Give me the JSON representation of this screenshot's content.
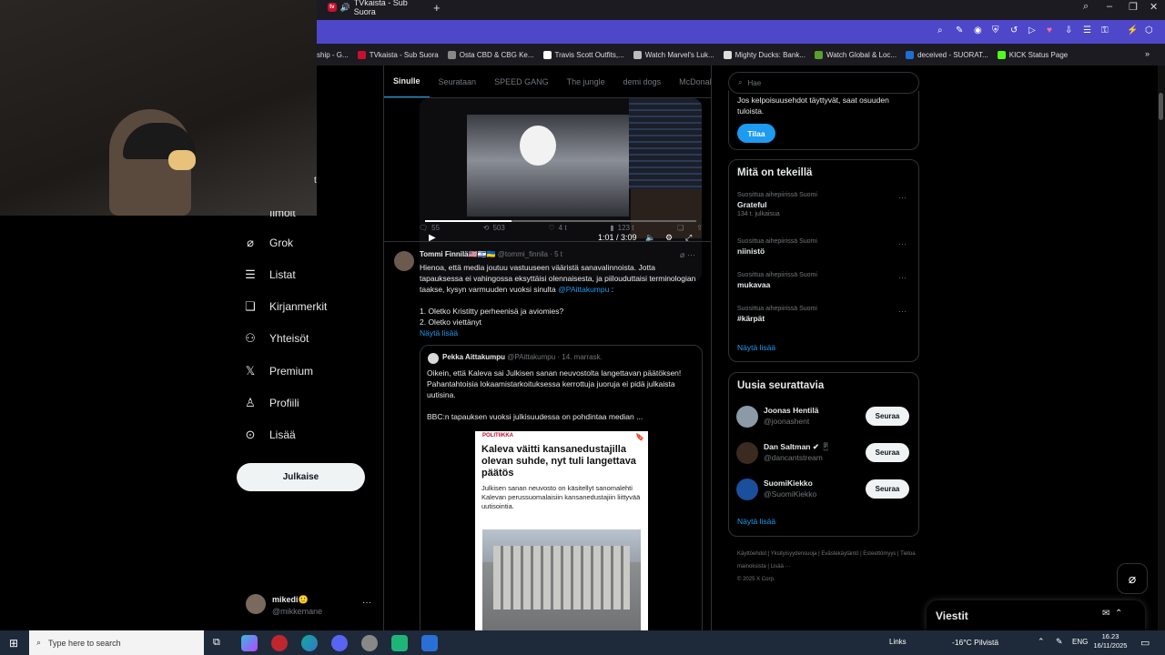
{
  "browser": {
    "active_tab": "TVkaista - Sub Suora",
    "new_tab_glyph": "+",
    "bookmarks": [
      {
        "label": "ship - G...",
        "color": "#34a853"
      },
      {
        "label": "TVkaista - Sub Suora",
        "color": "#c8102e"
      },
      {
        "label": "Osta CBD & CBG Ke...",
        "color": "#888888"
      },
      {
        "label": "Travis Scott Outfits,...",
        "color": "#ffffff"
      },
      {
        "label": "Watch Marvel's Luk...",
        "color": "#bbbbbb"
      },
      {
        "label": "Mighty Ducks: Bank...",
        "color": "#dddddd"
      },
      {
        "label": "Watch Global & Loc...",
        "color": "#5aa02c"
      },
      {
        "label": "deceived - SUORAT...",
        "color": "#1d6fd1"
      },
      {
        "label": "KICK Status Page",
        "color": "#53fc18"
      }
    ]
  },
  "webcam": {
    "label": "t"
  },
  "sidebar": {
    "partial_item": "Ilmoit",
    "items": [
      {
        "label": "Grok",
        "icon": "grok-icon",
        "glyph": "⌀"
      },
      {
        "label": "Listat",
        "icon": "list-icon",
        "glyph": "☰"
      },
      {
        "label": "Kirjanmerkit",
        "icon": "bookmark-icon",
        "glyph": "❏"
      },
      {
        "label": "Yhteisöt",
        "icon": "communities-icon",
        "glyph": "⚇"
      },
      {
        "label": "Premium",
        "icon": "x-logo-icon",
        "glyph": "𝕏"
      },
      {
        "label": "Profiili",
        "icon": "profile-icon",
        "glyph": "♙"
      },
      {
        "label": "Lisää",
        "icon": "more-icon",
        "glyph": "⊙"
      }
    ],
    "post_button": "Julkaise",
    "profile": {
      "name": "mikedi🙂",
      "handle": "@mikkemane",
      "more": "···"
    }
  },
  "feed": {
    "tabs": [
      "Sinulle",
      "Seurataan",
      "SPEED GANG",
      "The jungle",
      "demi dogs",
      "McDonal"
    ],
    "video": {
      "time": "1:01 / 3:09",
      "progress": 0.32
    },
    "video_actions": {
      "replies": "55",
      "reposts": "503",
      "likes": "4 t",
      "views": "123 t"
    },
    "tweet": {
      "author": "Tommi Finnilä🇺🇸🇮🇱🇺🇦",
      "handle": "@tommi_finnila",
      "time": "· 5 t",
      "body": "Hienoa, että media joutuu vastuuseen vääristä sanavalinnoista. Jotta tapauksessa ei vahingossa eksyttäisi olennaisesta, ja piilouduttaisi terminologian taakse, kysyn varmuuden vuoksi sinulta",
      "mention": "@PAittakumpu",
      "body_end": ":",
      "list_1": "1. Oletko Kristitty perheenisä ja aviomies?",
      "list_2": "2. Oletko viettänyt",
      "show_more": "Näytä lisää"
    },
    "quote": {
      "author": "Pekka Aittakumpu",
      "handle": "@PAittakumpu",
      "date": "· 14. marrask.",
      "body": "Oikein, että Kaleva sai Julkisen sanan neuvostolta langettavan päätöksen! Pahantahtoisia lokaamistarkoituksessa kerrottuja juoruja ei pidä julkaista uutisina.",
      "body2": "BBC:n tapauksen vuoksi julkisuudessa on pohdintaa median ...",
      "article": {
        "tag": "POLITIIKKA",
        "title": "Kaleva väitti kansanedustajilla olevan suhde, nyt tuli langettava päätös",
        "lede": "Julkisen sanan neuvosto on käsitellyt sanomalehti Kalevan perussuomalaisiin kansanedustajiin liittyvää uutisointia."
      }
    }
  },
  "right": {
    "search_placeholder": "Hae",
    "premium_text": "Jos kelpoisuusehdot täyttyvät, saat osuuden tuloista.",
    "subscribe": "Tilaa",
    "trends_title": "Mitä on tekeillä",
    "trends": [
      {
        "category": "Suosittua aihepiirissä Suomi",
        "name": "Grateful",
        "count": "134 t. julkaisua"
      },
      {
        "category": "Suosittua aihepiirissä Suomi",
        "name": "niinistö",
        "count": ""
      },
      {
        "category": "Suosittua aihepiirissä Suomi",
        "name": "mukavaa",
        "count": ""
      },
      {
        "category": "Suosittua aihepiirissä Suomi",
        "name": "#kärpät",
        "count": ""
      }
    ],
    "trends_show_more": "Näytä lisää",
    "follow_title": "Uusia seurattavia",
    "follow": [
      {
        "name": "Joonas Hentilä",
        "handle": "@joonashent",
        "button": "Seuraa",
        "color": "#8a9aa6"
      },
      {
        "name": "Dan Saltman ✔ 📱",
        "handle": "@dancantstream",
        "button": "Seuraa",
        "color": "#3b2a20"
      },
      {
        "name": "SuomiKiekko",
        "handle": "@SuomiKiekko",
        "button": "Seuraa",
        "color": "#1a4f9c"
      }
    ],
    "follow_show_more": "Näytä lisää",
    "footer": "Käyttöehdot  |  Yksityisyydensuoja  |  Evästekäytäntö  |  Esteettömyys  |  Tietoa mainoksista  |  Lisää ···",
    "copyright": "© 2025 X Corp.",
    "messages": "Viestit"
  },
  "taskbar": {
    "search_placeholder": "Type here to search",
    "links": "Links",
    "weather": "-16°C  Pilvistä",
    "lang": "ENG",
    "time": "16.23",
    "date": "16/11/2025"
  }
}
